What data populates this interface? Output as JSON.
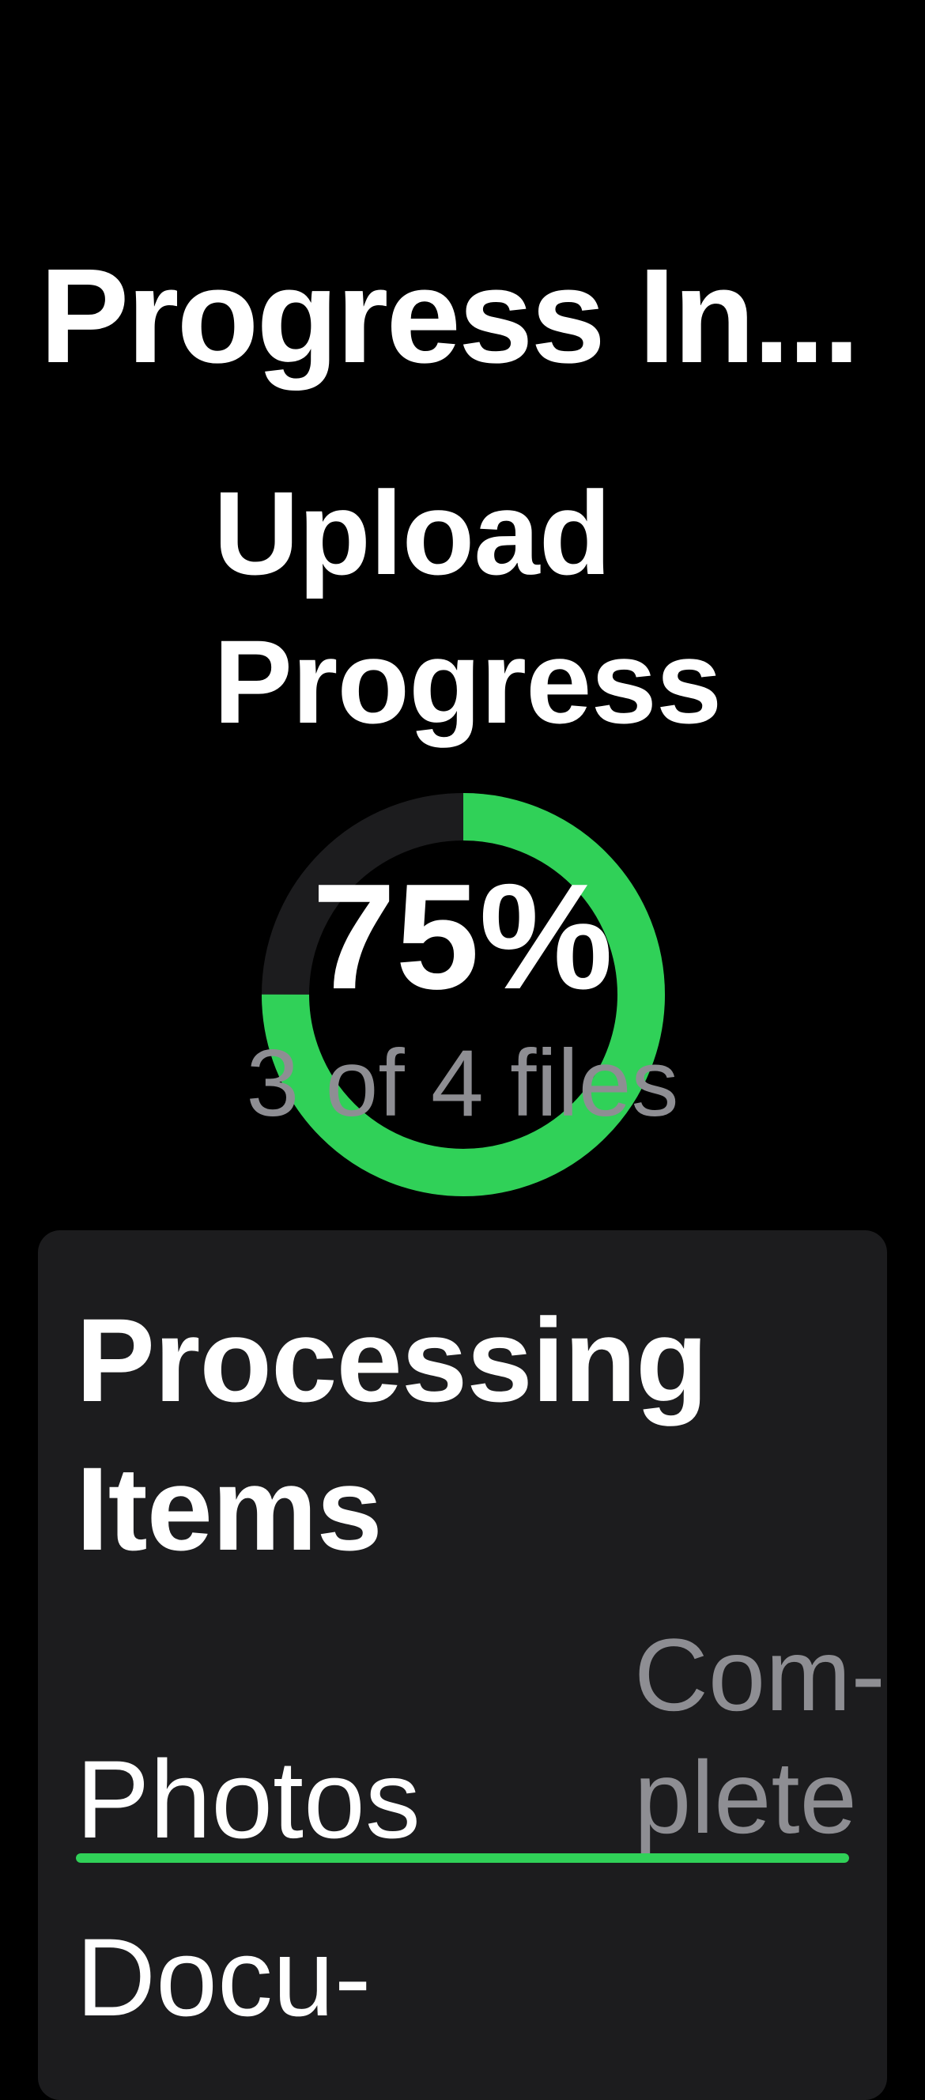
{
  "nav": {
    "title": "Progress In..."
  },
  "upload": {
    "title_line1": "Upload",
    "title_line2": "Progress",
    "progress": 0.75,
    "percent_label": "75%",
    "files_label": "3 of 4 files"
  },
  "processing": {
    "title_line1": "Processing",
    "title_line2": "Items",
    "items": [
      {
        "name": "Photos",
        "status_line1": "Com-",
        "status_line2": "plete",
        "progress": 1.0
      },
      {
        "name": "Docu-"
      }
    ]
  },
  "colors": {
    "background": "#000000",
    "card": "#1c1c1e",
    "accent_green": "#30d158",
    "ring_track": "#1c1c1e",
    "secondary_text": "#8e8e93"
  }
}
